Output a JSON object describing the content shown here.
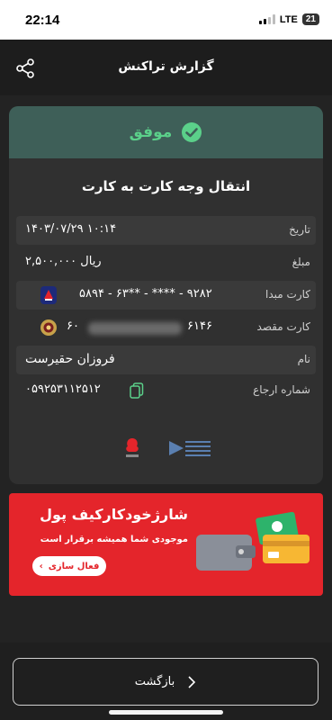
{
  "status_bar": {
    "time": "22:14",
    "network": "LTE",
    "battery": "21"
  },
  "header": {
    "title": "گزارش تراکنش",
    "share_icon": "share-icon"
  },
  "receipt": {
    "status": "موفق",
    "title": "انتقال وجه کارت به کارت",
    "rows": {
      "date": {
        "label": "تاریخ",
        "value": "۱۴۰۳/۰۷/۲۹ ۱۰:۱۴"
      },
      "amount": {
        "label": "مبلغ",
        "value": "۲,۵۰۰,۰۰۰ ریال"
      },
      "source_card": {
        "label": "کارت مبدا",
        "value": "۵۸۹۴ - ۶۳** - **** - ۹۲۸۲"
      },
      "dest_card": {
        "label": "کارت مقصد",
        "value_start": "۶۰",
        "value_end": "۶۱۴۶"
      },
      "name": {
        "label": "نام",
        "value": "فروزان حقیرست"
      },
      "reference": {
        "label": "شماره ارجاع",
        "value": "۰۵۹۲۵۳۱۱۲۵۱۲"
      }
    }
  },
  "banner": {
    "title": "شارژخودکارکیف پول",
    "subtitle": "موجودی شما همیشه برقرار است",
    "button": "فعال سازی"
  },
  "footer": {
    "back_label": "بازگشت"
  },
  "colors": {
    "success": "#5bd08a",
    "banner_red": "#e4252b",
    "card_bg": "#303030"
  }
}
